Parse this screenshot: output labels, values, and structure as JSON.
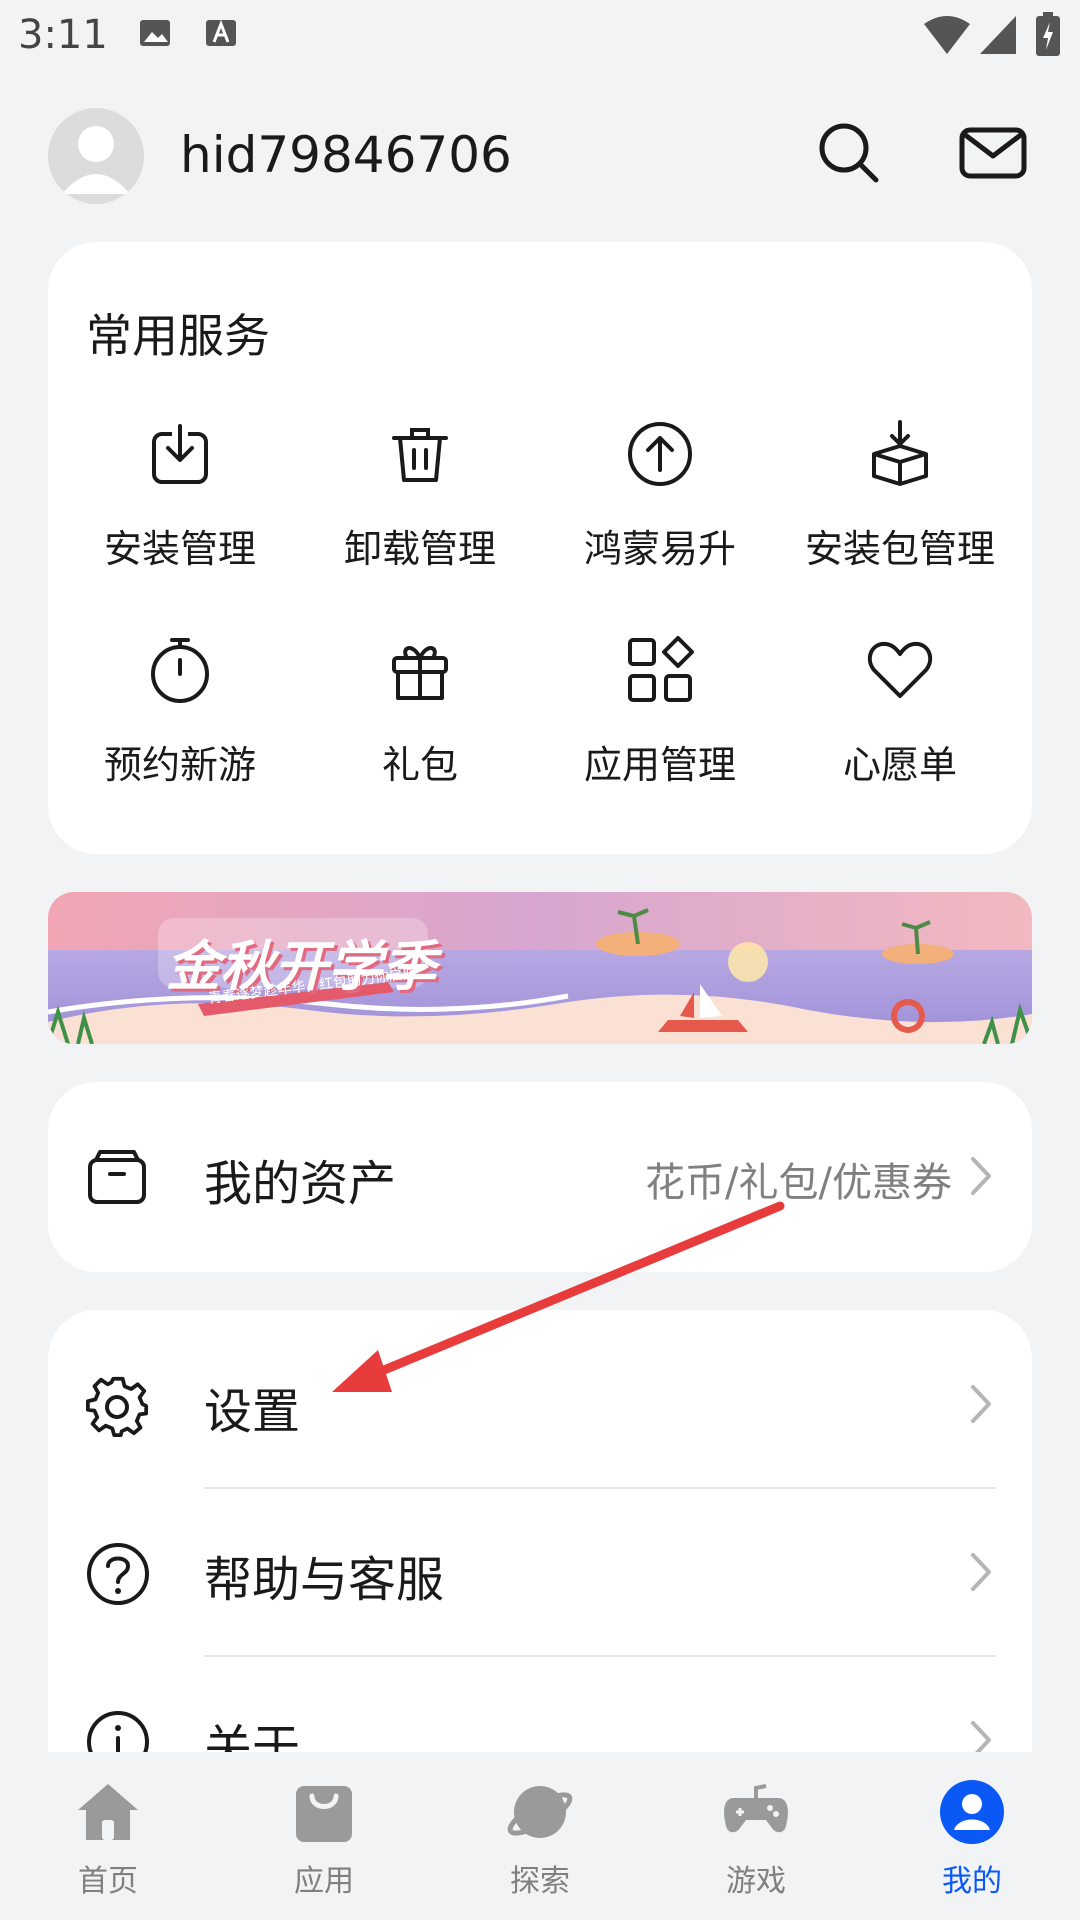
{
  "status_bar": {
    "time": "3:11"
  },
  "header": {
    "username": "hid79846706"
  },
  "common_services": {
    "title": "常用服务",
    "items": [
      {
        "label": "安装管理",
        "icon": "install-icon"
      },
      {
        "label": "卸载管理",
        "icon": "trash-icon"
      },
      {
        "label": "鸿蒙易升",
        "icon": "upgrade-icon"
      },
      {
        "label": "安装包管理",
        "icon": "package-icon"
      },
      {
        "label": "预约新游",
        "icon": "stopwatch-icon"
      },
      {
        "label": "礼包",
        "icon": "gift-icon"
      },
      {
        "label": "应用管理",
        "icon": "apps-grid-icon"
      },
      {
        "label": "心愿单",
        "icon": "heart-icon"
      }
    ]
  },
  "banner": {
    "title": "金秋开学季",
    "subtitle": "青春逐梦趁年华，红包助力你启航"
  },
  "assets": {
    "label": "我的资产",
    "detail": "花币/礼包/优惠券"
  },
  "menu": [
    {
      "label": "设置",
      "icon": "gear-icon"
    },
    {
      "label": "帮助与客服",
      "icon": "help-icon"
    },
    {
      "label": "关于",
      "icon": "info-icon"
    }
  ],
  "tabs": [
    {
      "label": "首页",
      "icon": "home-icon",
      "active": false
    },
    {
      "label": "应用",
      "icon": "bag-icon",
      "active": false
    },
    {
      "label": "探索",
      "icon": "planet-icon",
      "active": false
    },
    {
      "label": "游戏",
      "icon": "gamepad-icon",
      "active": false
    },
    {
      "label": "我的",
      "icon": "person-icon",
      "active": true
    }
  ],
  "colors": {
    "accent": "#0a59f7",
    "annotation_arrow": "#e83b3b",
    "background": "#f1f3f5"
  }
}
